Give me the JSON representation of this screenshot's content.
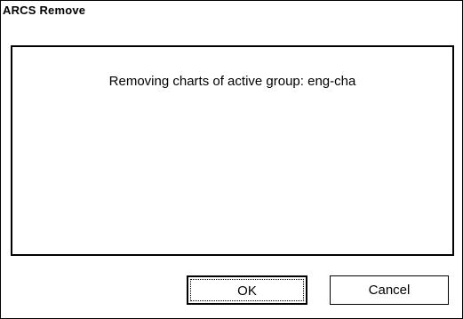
{
  "window": {
    "title": "ARCS Remove"
  },
  "message": {
    "text": "Removing charts of active group: eng-cha"
  },
  "buttons": {
    "ok_label": "OK",
    "cancel_label": "Cancel"
  }
}
